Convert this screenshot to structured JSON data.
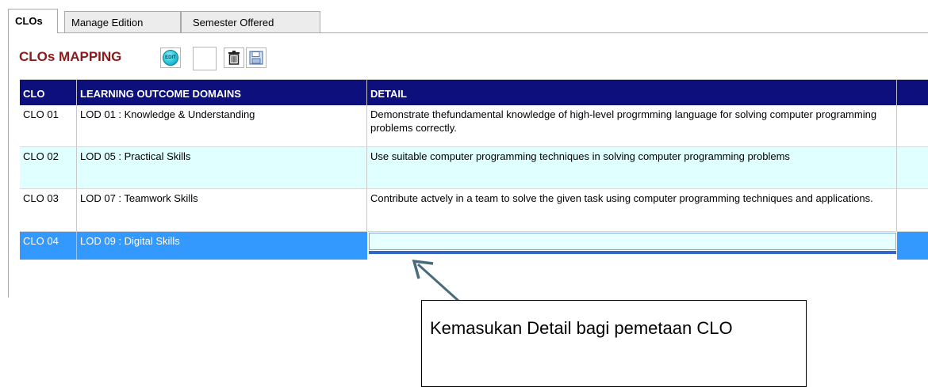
{
  "tabs": [
    {
      "label": "CLOs",
      "active": true
    },
    {
      "label": "Manage Edition",
      "active": false
    },
    {
      "label": "Semester Offered",
      "active": false
    }
  ],
  "section_title": "CLOs MAPPING",
  "toolbar": {
    "edit_icon_text": "EDIT",
    "icons": [
      "edit-icon",
      "blank-button",
      "trash-icon",
      "save-icon"
    ]
  },
  "table": {
    "headers": [
      "CLO",
      "LEARNING OUTCOME DOMAINS",
      "DETAIL",
      ""
    ],
    "rows": [
      {
        "clo": "CLO 01",
        "domain": "LOD 01 : Knowledge & Understanding",
        "detail": "Demonstrate thefundamental knowledge of high-level progrmming language for solving computer programming problems correctly."
      },
      {
        "clo": "CLO 02",
        "domain": "LOD 05 : Practical Skills",
        "detail": "Use suitable computer programming techniques in solving computer programming problems"
      },
      {
        "clo": "CLO 03",
        "domain": "LOD 07 : Teamwork Skills",
        "detail": "Contribute actvely in a team to solve the given task using computer programming techniques and applications."
      },
      {
        "clo": "CLO 04",
        "domain": "LOD 09 : Digital Skills",
        "detail": ""
      }
    ]
  },
  "callout": {
    "text": "Kemasukan Detail bagi pemetaan CLO"
  },
  "colors": {
    "header_bg": "#0c0f7c",
    "title": "#8b1a1a",
    "alt_row": "#e0ffff",
    "selected_row": "#3399ff"
  }
}
